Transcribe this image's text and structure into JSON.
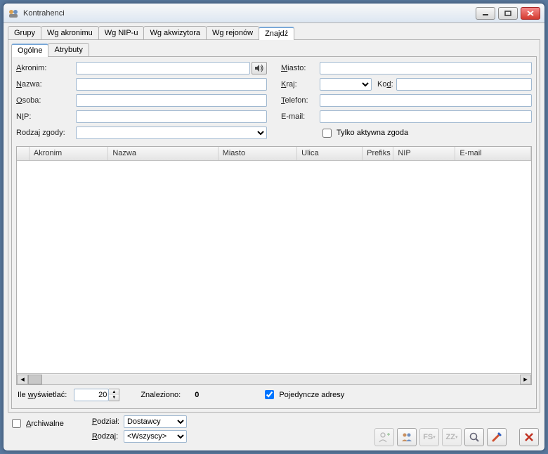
{
  "window": {
    "title": "Kontrahenci"
  },
  "tabs_outer": [
    {
      "label": "Grupy",
      "active": false
    },
    {
      "label": "Wg akronimu",
      "active": false
    },
    {
      "label": "Wg NIP-u",
      "active": false
    },
    {
      "label": "Wg akwizytora",
      "active": false
    },
    {
      "label": "Wg rejonów",
      "active": false
    },
    {
      "label": "Znajdź",
      "active": true
    }
  ],
  "tabs_inner": [
    {
      "label": "Ogólne",
      "active": true
    },
    {
      "label": "Atrybuty",
      "active": false
    }
  ],
  "form": {
    "akronim_label": "Akronim:",
    "nazwa_label": "Nazwa:",
    "osoba_label": "Osoba:",
    "nip_label": "NIP:",
    "rodzaj_zgody_label": "Rodzaj zgody:",
    "miasto_label": "Miasto:",
    "kraj_label": "Kraj:",
    "kod_label": "Kod:",
    "telefon_label": "Telefon:",
    "email_label": "E-mail:",
    "tylko_aktywna_label": "Tylko aktywna zgoda",
    "akronim": "",
    "nazwa": "",
    "osoba": "",
    "nip": "",
    "rodzaj_zgody": "",
    "miasto": "",
    "kraj": "",
    "kod": "",
    "telefon": "",
    "email": "",
    "tylko_aktywna": false
  },
  "grid": {
    "columns": [
      "Akronim",
      "Nazwa",
      "Miasto",
      "Ulica",
      "Prefiks",
      "NIP",
      "E-mail"
    ],
    "rows": []
  },
  "status": {
    "ile_label": "Ile wyświetlać:",
    "ile_value": "20",
    "znaleziono_label": "Znaleziono:",
    "znaleziono_value": "0",
    "pojedyncze_label": "Pojedyncze adresy",
    "pojedyncze_checked": true
  },
  "bottom": {
    "archiwalne_label": "Archiwalne",
    "archiwalne_checked": false,
    "podzial_label": "Podział:",
    "podzial_value": "Dostawcy",
    "rodzaj_label": "Rodzaj:",
    "rodzaj_value": "<Wszyscy>"
  },
  "toolbar_icons": {
    "add_person": "add-person-icon",
    "groups": "groups-icon",
    "fs": "FS",
    "zz": "ZZ",
    "search": "search-icon",
    "edit": "edit-icon",
    "close": "close-icon"
  }
}
